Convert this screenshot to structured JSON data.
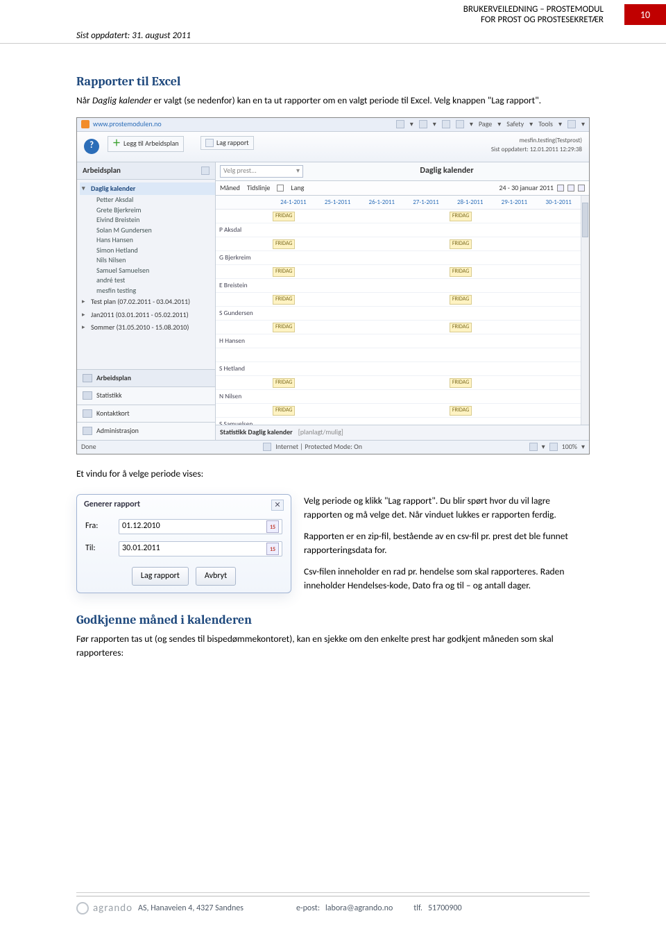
{
  "header": {
    "title_line1": "BRUKERVEILEDNING – PROSTEMODUL",
    "title_line2": "FOR PROST OG PROSTESEKRETÆR",
    "page_number": "10",
    "updated": "Sist oppdatert: 31. august 2011"
  },
  "section1": {
    "heading": "Rapporter til Excel",
    "para_before": "Når ",
    "italic": "Daglig kalender",
    "para_after": " er valgt (se nedenfor) kan en ta ut rapporter om en valgt periode til Excel. Velg knappen \"Lag rapport\"."
  },
  "app": {
    "address": "www.prostemodulen.no",
    "menu_page": "Page",
    "menu_safety": "Safety",
    "menu_tools": "Tools",
    "btn_add": "Legg til Arbeidsplan",
    "btn_report": "Lag rapport",
    "userline": "mesfin.testing(Testprost)",
    "lastupdate": "Sist oppdatert: 12.01.2011 12:29:38",
    "left_header": "Arbeidsplan",
    "tree_root": "Daglig kalender",
    "people": [
      "Petter  Aksdal",
      "Grete  Bjerkreim",
      "Eivind  Breistein",
      "Solan M  Gundersen",
      "Hans  Hansen",
      "Simon  Hetland",
      "Nils  Nilsen",
      "Samuel  Samuelsen",
      "andré  test",
      "mesfin  testing"
    ],
    "plans": [
      "Test plan (07.02.2011 - 03.04.2011)",
      "Jan2011 (03.01.2011 - 05.02.2011)",
      "Sommer (31.05.2010 - 15.08.2010)"
    ],
    "btabs": [
      "Arbeidsplan",
      "Statistikk",
      "Kontaktkort",
      "Administrasjon"
    ],
    "dd_placeholder": "Velg prest...",
    "main_title": "Daglig kalender",
    "ctrl_maned": "Måned",
    "ctrl_tidslinje": "Tidslinje",
    "ctrl_lang": "Lang",
    "daterange": "24 - 30 januar 2011",
    "cols": [
      "",
      "24-1-2011",
      "25-1-2011",
      "26-1-2011",
      "27-1-2011",
      "28-1-2011",
      "29-1-2011",
      "30-1-2011"
    ],
    "rows": [
      {
        "name": "P Aksdal",
        "fridag": [
          0,
          4
        ]
      },
      {
        "name": "G Bjerkreim",
        "fridag": [
          0,
          4
        ]
      },
      {
        "name": "E Breistein",
        "fridag": [
          0,
          4
        ]
      },
      {
        "name": "S Gundersen",
        "fridag": [
          0,
          4
        ]
      },
      {
        "name": "H Hansen",
        "fridag": [
          0,
          4
        ]
      },
      {
        "name": "S Hetland",
        "fridag": []
      },
      {
        "name": "N Nilsen",
        "fridag": [
          0,
          4
        ]
      },
      {
        "name": "S Samuelsen",
        "fridag": [
          0,
          4
        ]
      }
    ],
    "fridag_label": "FRIDAG",
    "stat_label": "Statistikk Daglig kalender",
    "stat_sub": "[planlagt/mulig]",
    "status_done": "Done",
    "status_mode": "Internet | Protected Mode: On",
    "status_zoom": "100%"
  },
  "belowintro": "Et vindu for å velge periode vises:",
  "genrep": {
    "title": "Generer rapport",
    "fra_label": "Fra:",
    "til_label": "Til:",
    "fra_val": "01.12.2010",
    "til_val": "30.01.2011",
    "btn_make": "Lag rapport",
    "btn_cancel": "Avbryt"
  },
  "side": {
    "p1": "Velg periode og klikk \"Lag rapport\". Du blir spørt hvor du vil lagre rapporten og må velge det. Når vinduet lukkes er rapporten ferdig.",
    "p2": "Rapporten er en zip-fil, bestående av en csv-fil pr. prest det ble funnet rapporteringsdata for.",
    "p3": "Csv-filen inneholder en rad pr. hendelse som skal rapporteres. Raden inneholder Hendelses-kode, Dato fra og til – og antall dager."
  },
  "section2": {
    "heading": "Godkjenne måned i kalenderen",
    "para": "Før rapporten tas ut (og sendes til bispedømmekontoret), kan en sjekke om den enkelte prest har godkjent måneden som skal rapporteres:"
  },
  "footer": {
    "brand": "agrando",
    "addr": " AS, Hanaveien 4, 4327 Sandnes",
    "email_label": "e-post: ",
    "email": "labora@agrando.no",
    "tel_label": "tlf. ",
    "tel": "51700900"
  }
}
